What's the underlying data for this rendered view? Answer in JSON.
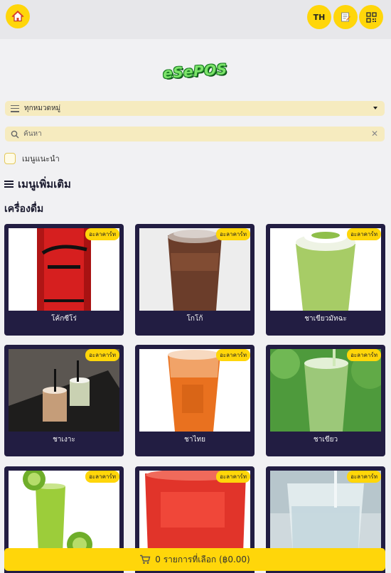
{
  "topbar": {
    "language": "TH"
  },
  "logo": {
    "text": "eSePOS"
  },
  "filters": {
    "category_select": "ทุกหมวดหมู่",
    "search_placeholder": "ค้นหา",
    "recommend_label": "เมนูแนะนำ"
  },
  "section": {
    "title": "เมนูเพิ่มเติม",
    "category": "เครื่องดื่ม"
  },
  "items": [
    {
      "name": "โค้กซีโร่",
      "badge": "อะลาคาร์ท"
    },
    {
      "name": "โกโก้",
      "badge": "อะลาคาร์ท"
    },
    {
      "name": "ชาเขียวมัทฉะ",
      "badge": "อะลาคาร์ท"
    },
    {
      "name": "ชาเงาะ",
      "badge": "อะลาคาร์ท"
    },
    {
      "name": "ชาไทย",
      "badge": "อะลาคาร์ท"
    },
    {
      "name": "ชาเขียว",
      "badge": "อะลาคาร์ท"
    },
    {
      "name": "",
      "badge": "อะลาคาร์ท"
    },
    {
      "name": "",
      "badge": "อะลาคาร์ท"
    },
    {
      "name": "",
      "badge": "อะลาคาร์ท"
    }
  ],
  "cart": {
    "label": "0 รายการที่เลือก (฿0.00)"
  },
  "colors": {
    "accent": "#ffd60a",
    "card": "#221d42",
    "input_bg": "#f6ebbf"
  }
}
